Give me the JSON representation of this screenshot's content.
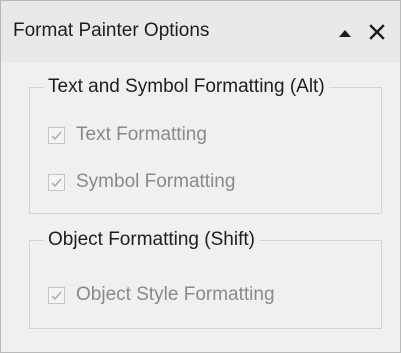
{
  "panel": {
    "title": "Format Painter Options",
    "collapse_icon": "triangle-up-icon",
    "close_icon": "close-x-icon"
  },
  "groups": [
    {
      "legend": "Text and Symbol Formatting (Alt)",
      "options": [
        {
          "label": "Text Formatting",
          "checked": true,
          "enabled": false
        },
        {
          "label": "Symbol Formatting",
          "checked": true,
          "enabled": false
        }
      ]
    },
    {
      "legend": "Object Formatting (Shift)",
      "options": [
        {
          "label": "Object Style Formatting",
          "checked": true,
          "enabled": false
        }
      ]
    }
  ],
  "colors": {
    "titlebar_bg": "#e9e9e9",
    "body_bg": "#f0f0f0",
    "disabled_text": "#8a8a8a"
  }
}
